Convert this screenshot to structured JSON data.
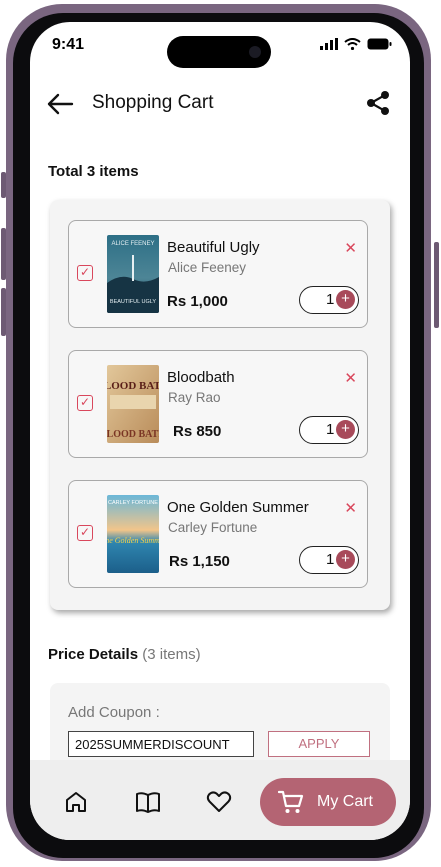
{
  "status": {
    "time": "9:41"
  },
  "header": {
    "title": "Shopping Cart"
  },
  "cart": {
    "total_label": "Total 3 items",
    "items": [
      {
        "title": "Beautiful Ugly",
        "author": "Alice Feeney",
        "price": "Rs 1,000",
        "qty": "1",
        "checked": true,
        "cover_text_top": "ALICE FEENEY",
        "cover_text_bottom": "BEAUTIFUL UGLY"
      },
      {
        "title": "Bloodbath",
        "author": "Ray Rao",
        "price": "Rs 850",
        "qty": "1",
        "checked": true,
        "cover_text_top": "BLOOD BATH",
        "cover_text_bottom": "BLOOD BATH"
      },
      {
        "title": "One Golden Summer",
        "author": "Carley Fortune",
        "price": "Rs 1,150",
        "qty": "1",
        "checked": true,
        "cover_text_top": "CARLEY FORTUNE",
        "cover_text_bottom": "One Golden Summer"
      }
    ]
  },
  "price_details": {
    "label": "Price Details",
    "count": "(3 items)"
  },
  "coupon": {
    "label": "Add Coupon :",
    "value": "2025SUMMERDISCOUNT",
    "apply_label": "APPLY"
  },
  "nav": {
    "cart_label": "My Cart"
  },
  "colors": {
    "accent": "#b46473",
    "remove": "#d9475c",
    "frame": "#7a6680"
  },
  "icons": [
    "back-arrow-icon",
    "share-icon",
    "check-icon",
    "close-icon",
    "plus-icon",
    "home-icon",
    "book-icon",
    "heart-icon",
    "cart-icon"
  ]
}
